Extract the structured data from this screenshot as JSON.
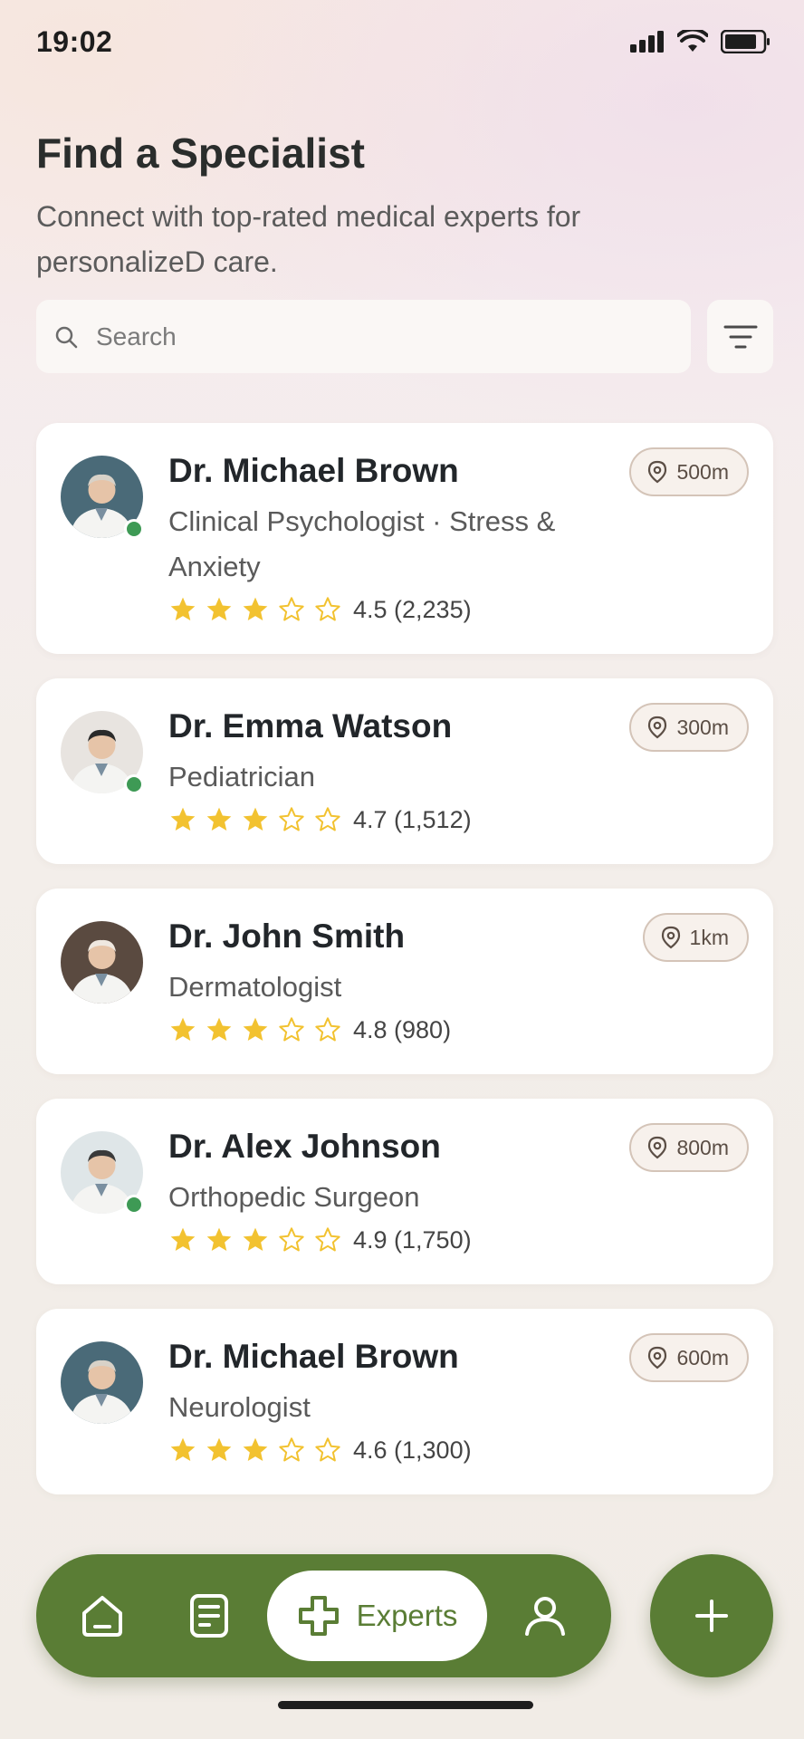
{
  "status_bar": {
    "time": "19:02"
  },
  "header": {
    "title": "Find a Specialist",
    "subtitle": "Connect with top-rated medical experts for personalizeD care."
  },
  "search": {
    "placeholder": "Search"
  },
  "doctors": [
    {
      "name": "Dr. Michael Brown",
      "specialty": "Clinical Psychologist · Stress & Anxiety",
      "rating": 4.5,
      "filled_stars": 3,
      "rating_text": "4.5 (2,235)",
      "distance": "500m",
      "online": true
    },
    {
      "name": "Dr. Emma Watson",
      "specialty": "Pediatrician",
      "rating": 4.7,
      "filled_stars": 3,
      "rating_text": "4.7 (1,512)",
      "distance": "300m",
      "online": true
    },
    {
      "name": "Dr. John Smith",
      "specialty": "Dermatologist",
      "rating": 4.8,
      "filled_stars": 3,
      "rating_text": "4.8 (980)",
      "distance": "1km",
      "online": false
    },
    {
      "name": "Dr. Alex Johnson",
      "specialty": "Orthopedic Surgeon",
      "rating": 4.9,
      "filled_stars": 3,
      "rating_text": "4.9 (1,750)",
      "distance": "800m",
      "online": true
    },
    {
      "name": "Dr. Michael Brown",
      "specialty": "Neurologist",
      "rating": 4.6,
      "filled_stars": 3,
      "rating_text": "4.6 (1,300)",
      "distance": "600m",
      "online": false
    }
  ],
  "bottom_nav": {
    "items": [
      "home-icon",
      "document-icon",
      "experts-icon",
      "profile-icon"
    ],
    "active_label": "Experts"
  },
  "colors": {
    "accent": "#5a7d35",
    "star": "#f2c230",
    "online": "#3e9a55"
  }
}
